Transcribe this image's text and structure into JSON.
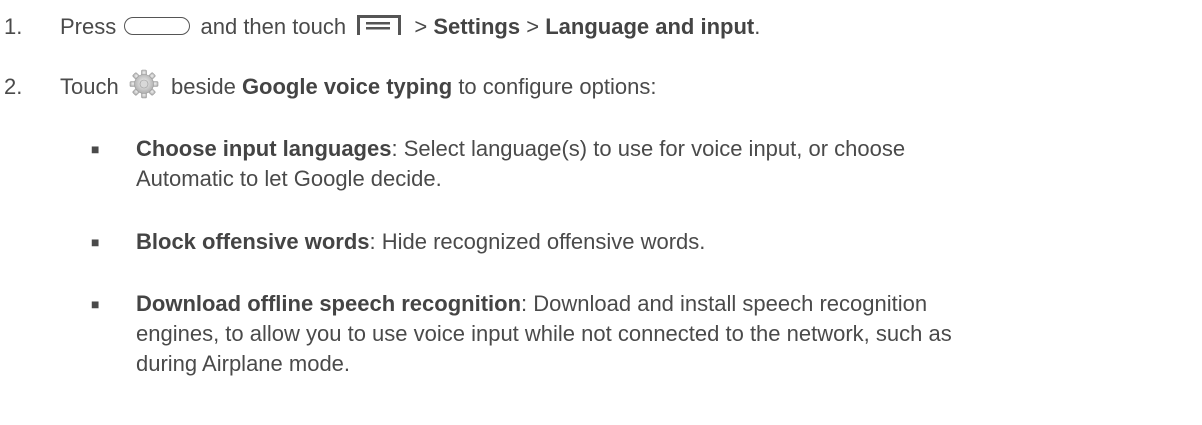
{
  "step1": {
    "number": "1.",
    "press": "Press",
    "and_then_touch": "and then touch",
    "sep1": ">",
    "settings": "Settings",
    "sep2": ">",
    "language_and_input": "Language and input",
    "period": "."
  },
  "step2": {
    "number": "2.",
    "touch": "Touch",
    "beside": "beside",
    "google_voice_typing": "Google voice typing",
    "to_configure": "to configure options:"
  },
  "options": [
    {
      "title": "Choose input languages",
      "line1": ": Select language(s) to use for voice input, or choose",
      "line2": "Automatic to let Google decide."
    },
    {
      "title": "Block offensive words",
      "line1": ": Hide recognized offensive words."
    },
    {
      "title": "Download offline speech recognition",
      "line1": ": Download and install speech recognition",
      "line2": "engines, to allow you to use voice input while not connected to the network, such as",
      "line3": "during Airplane mode."
    }
  ],
  "icons": {
    "home": "home-button-icon",
    "menu": "menu-icon",
    "settings_gear": "gear-icon"
  },
  "colors": {
    "text": "#4a4a4a",
    "bold": "#444444"
  }
}
